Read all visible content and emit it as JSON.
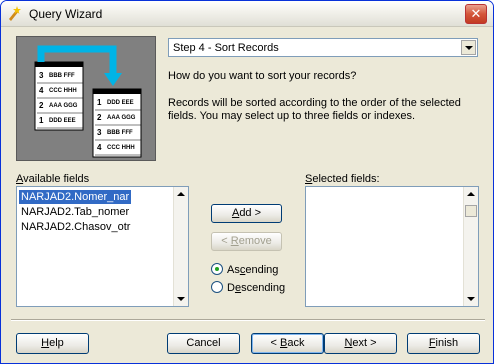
{
  "window": {
    "title": "Query Wizard",
    "close_label": "✕"
  },
  "step_select": {
    "value": "Step 4 - Sort Records"
  },
  "question": "How do you want to sort your records?",
  "description": "Records will be sorted according to the order of the selected fields. You may select up to three fields or indexes.",
  "available": {
    "label_pre": "",
    "label_ul": "A",
    "label_post": "vailable fields",
    "items": [
      "NARJAD2.Nomer_nar",
      "NARJAD2.Tab_nomer",
      "NARJAD2.Chasov_otr"
    ],
    "selected_index": 0
  },
  "selected": {
    "label_pre": "",
    "label_ul": "S",
    "label_post": "elected fields:",
    "items": []
  },
  "buttons": {
    "add": {
      "pre": "",
      "ul": "A",
      "post": "dd >"
    },
    "remove": {
      "pre": "< ",
      "ul": "R",
      "post": "emove"
    },
    "help": {
      "pre": "",
      "ul": "H",
      "post": "elp"
    },
    "cancel": {
      "pre": "Cancel",
      "ul": "",
      "post": ""
    },
    "back": {
      "pre": "< ",
      "ul": "B",
      "post": "ack"
    },
    "next": {
      "pre": "",
      "ul": "N",
      "post": "ext >"
    },
    "finish": {
      "pre": "",
      "ul": "F",
      "post": "inish"
    }
  },
  "sort_order": {
    "ascending": {
      "pre": "As",
      "ul": "c",
      "post": "ending"
    },
    "descending": {
      "pre": "D",
      "ul": "e",
      "post": "scending"
    },
    "selected": "ascending"
  },
  "illustration": {
    "back_rows": [
      {
        "num": "3",
        "text": "BBB FFF"
      },
      {
        "num": "4",
        "text": "CCC HHH"
      },
      {
        "num": "2",
        "text": "AAA GGG"
      },
      {
        "num": "1",
        "text": "DDD EEE"
      }
    ],
    "front_rows": [
      {
        "num": "1",
        "text": "DDD EEE"
      },
      {
        "num": "2",
        "text": "AAA GGG"
      },
      {
        "num": "3",
        "text": "BBB FFF"
      },
      {
        "num": "4",
        "text": "CCC HHH"
      }
    ]
  },
  "colors": {
    "accent": "#316ac5",
    "arrow": "#00b4e6",
    "panel_bg": "#808080"
  }
}
